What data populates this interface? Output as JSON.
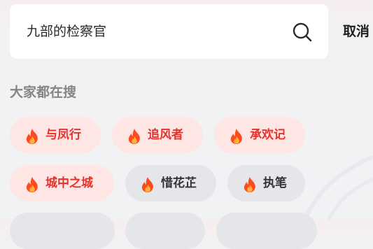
{
  "search": {
    "query": "九部的检察官",
    "cancel_label": "取消"
  },
  "trending": {
    "title": "大家都在搜",
    "tags": [
      {
        "label": "与凤行",
        "hot": true
      },
      {
        "label": "追风者",
        "hot": true
      },
      {
        "label": "承欢记",
        "hot": true
      },
      {
        "label": "城中之城",
        "hot": true
      },
      {
        "label": "惜花芷",
        "hot": false
      },
      {
        "label": "执笔",
        "hot": false
      }
    ]
  },
  "icons": {
    "search": "search-icon",
    "tag_marker": "flame-icon"
  },
  "colors": {
    "hot_text": "#e8312b",
    "hot_bg": "#fde6e4",
    "normal_text": "#333333",
    "normal_bg": "#e4e6ea",
    "flame_outer": "#ff4a1f",
    "flame_inner": "#ffb23a"
  }
}
